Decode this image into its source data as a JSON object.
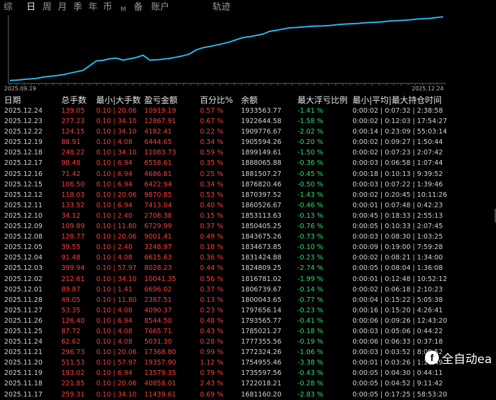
{
  "tabs": [
    {
      "label": "综",
      "active": false
    },
    {
      "label": "日",
      "active": true
    },
    {
      "label": "周",
      "active": false
    },
    {
      "label": "月",
      "active": false
    },
    {
      "label": "季",
      "active": false
    },
    {
      "label": "年",
      "active": false
    },
    {
      "label": "币",
      "active": false
    },
    {
      "label": "M",
      "active": false
    },
    {
      "label": "备",
      "active": false
    },
    {
      "label": "账户",
      "active": false
    }
  ],
  "chart": {
    "title": "轨迹",
    "x_start_label": "2025.09.19",
    "x_end_label": "2025.12.24",
    "line_color": "#2ab6f2"
  },
  "chart_data": {
    "type": "line",
    "title": "轨迹",
    "x_range": [
      "2025.09.19",
      "2025.12.24"
    ],
    "series": [
      {
        "values": [
          1002000,
          1008000,
          1018000,
          1026000,
          1034000,
          1052000,
          1064000,
          1074000,
          1088000,
          1110000,
          1130000,
          1152000,
          1220000,
          1290000,
          1298000,
          1320000,
          1330000,
          1300000,
          1320000,
          1340000,
          1372000,
          1300000,
          1305000,
          1314000,
          1326000,
          1344000,
          1364000,
          1392000,
          1452000,
          1482000,
          1500000,
          1520000,
          1542000,
          1566000,
          1600000,
          1630000,
          1642000,
          1662000,
          1681160,
          1722018,
          1735597,
          1754955,
          1772324,
          1777355,
          1785021,
          1793565,
          1797656,
          1800043,
          1806739,
          1816781,
          1824809,
          1831424,
          1834673,
          1843675,
          1850405,
          1853113,
          1860526,
          1870397,
          1876820,
          1881507,
          1888065,
          1899149,
          1905594,
          1909776,
          1922644,
          1933563
        ]
      }
    ],
    "color": "#2ab6f2"
  },
  "table": {
    "headers": {
      "date": "日期",
      "lots": "总手数",
      "minmax": "最小|大手数",
      "pl": "盈亏金额",
      "pct": "百分比%",
      "balance": "余额",
      "float": "最大浮亏比例",
      "time": "最小|平均|最大持仓时间"
    },
    "rows": [
      {
        "date": "2025.12.24",
        "lots": "139.05",
        "minmax": "0.10 | 20.06",
        "pl": "10919.19",
        "pct": "0.57 %",
        "balance": "1933563.77",
        "float": "-1.41 %",
        "time": "0:00:02 | 0:07:32 | 2:38:58"
      },
      {
        "date": "2025.12.23",
        "lots": "277.23",
        "minmax": "0.10 | 34.10",
        "pl": "12867.91",
        "pct": "0.67 %",
        "balance": "1922644.58",
        "float": "-1.58 %",
        "time": "0:00:02 | 0:12:03 | 17:54:27"
      },
      {
        "date": "2025.12.22",
        "lots": "124.15",
        "minmax": "0.10 | 34.10",
        "pl": "4182.41",
        "pct": "0.22 %",
        "balance": "1909776.67",
        "float": "-2.02 %",
        "time": "0:00:14 | 0:23:09 | 55:03:14"
      },
      {
        "date": "2025.12.19",
        "lots": "88.91",
        "minmax": "0.10 | 4.08",
        "pl": "6444.65",
        "pct": "0.34 %",
        "balance": "1905594.26",
        "float": "-0.20 %",
        "time": "0:00:02 | 0:09:27 | 1:50:44"
      },
      {
        "date": "2025.12.18",
        "lots": "248.22",
        "minmax": "0.10 | 34.10",
        "pl": "11083.73",
        "pct": "0.59 %",
        "balance": "1899149.61",
        "float": "-1.50 %",
        "time": "0:00:02 | 0:07:23 | 2:07:42"
      },
      {
        "date": "2025.12.17",
        "lots": "98.48",
        "minmax": "0.10 | 6.94",
        "pl": "6558.61",
        "pct": "0.35 %",
        "balance": "1888065.88",
        "float": "-0.36 %",
        "time": "0:00:03 | 0:06:58 | 1:07:44"
      },
      {
        "date": "2025.12.16",
        "lots": "71.42",
        "minmax": "0.10 | 6.94",
        "pl": "4686.81",
        "pct": "0.25 %",
        "balance": "1881507.27",
        "float": "-0.45 %",
        "time": "0:00:18 | 0:10:13 | 9:39:52"
      },
      {
        "date": "2025.12.15",
        "lots": "106.50",
        "minmax": "0.10 | 6.94",
        "pl": "6422.94",
        "pct": "0.34 %",
        "balance": "1876820.46",
        "float": "-0.50 %",
        "time": "0:00:03 | 0:07:22 | 1:39:46"
      },
      {
        "date": "2025.12.12",
        "lots": "118.03",
        "minmax": "0.10 | 20.06",
        "pl": "9870.85",
        "pct": "0.53 %",
        "balance": "1870397.52",
        "float": "-1.43 %",
        "time": "0:00:02 | 0:20:45 | 10:11:26"
      },
      {
        "date": "2025.12.11",
        "lots": "133.52",
        "minmax": "0.10 | 6.94",
        "pl": "7413.04",
        "pct": "0.40 %",
        "balance": "1860526.67",
        "float": "-0.46 %",
        "time": "0:00:01 | 0:07:48 | 0:42:23"
      },
      {
        "date": "2025.12.10",
        "lots": "34.12",
        "minmax": "0.10 | 2.40",
        "pl": "2708.38",
        "pct": "0.15 %",
        "balance": "1853113.63",
        "float": "-0.13 %",
        "time": "0:00:45 | 0:18:33 | 2:55:13"
      },
      {
        "date": "2025.12.09",
        "lots": "109.89",
        "minmax": "0.10 | 11.80",
        "pl": "6729.99",
        "pct": "0.37 %",
        "balance": "1850405.25",
        "float": "-0.76 %",
        "time": "0:00:05 | 0:10:33 | 2:07:45"
      },
      {
        "date": "2025.12.08",
        "lots": "128.77",
        "minmax": "0.10 | 20.06",
        "pl": "9001.41",
        "pct": "0.49 %",
        "balance": "1843675.26",
        "float": "-0.73 %",
        "time": "0:00:03 | 0:08:30 | 1:03:25"
      },
      {
        "date": "2025.12.05",
        "lots": "39.55",
        "minmax": "0.10 | 2.40",
        "pl": "3248.97",
        "pct": "0.18 %",
        "balance": "1834673.85",
        "float": "-0.10 %",
        "time": "0:00:09 | 0:19:00 | 7:59:28"
      },
      {
        "date": "2025.12.04",
        "lots": "91.48",
        "minmax": "0.10 | 4.08",
        "pl": "6615.63",
        "pct": "0.36 %",
        "balance": "1831424.88",
        "float": "-0.23 %",
        "time": "0:00:02 | 0:08:21 | 1:34:00"
      },
      {
        "date": "2025.12.03",
        "lots": "399.94",
        "minmax": "0.10 | 57.97",
        "pl": "8028.23",
        "pct": "0.44 %",
        "balance": "1824809.25",
        "float": "-2.74 %",
        "time": "0:00:05 | 0:08:04 | 1:36:08"
      },
      {
        "date": "2025.12.02",
        "lots": "212.61",
        "minmax": "0.10 | 34.10",
        "pl": "10041.35",
        "pct": "0.56 %",
        "balance": "1816781.02",
        "float": "-1.99 %",
        "time": "0:00:01 | 0:12:48 | 10:52:12"
      },
      {
        "date": "2025.12.01",
        "lots": "89.87",
        "minmax": "0.10 | 1.41",
        "pl": "6696.02",
        "pct": "0.37 %",
        "balance": "1806739.67",
        "float": "-0.14 %",
        "time": "0:00:02 | 0:06:18 | 2:10:23"
      },
      {
        "date": "2025.11.28",
        "lots": "49.05",
        "minmax": "0.10 | 11.80",
        "pl": "2387.51",
        "pct": "0.13 %",
        "balance": "1800043.65",
        "float": "-0.77 %",
        "time": "0:00:04 | 0:15:22 | 5:05:38"
      },
      {
        "date": "2025.11.27",
        "lots": "53.35",
        "minmax": "0.10 | 4.08",
        "pl": "4090.37",
        "pct": "0.23 %",
        "balance": "1797656.14",
        "float": "-0.23 %",
        "time": "0:00:16 | 0:15:20 | 4:26:41"
      },
      {
        "date": "2025.11.26",
        "lots": "126.40",
        "minmax": "0.10 | 6.94",
        "pl": "8544.50",
        "pct": "0.48 %",
        "balance": "1793565.77",
        "float": "-0.41 %",
        "time": "0:00:06 | 0:09:26 | 12:43:20"
      },
      {
        "date": "2025.11.25",
        "lots": "87.72",
        "minmax": "0.10 | 4.08",
        "pl": "7665.71",
        "pct": "0.43 %",
        "balance": "1785021.27",
        "float": "-0.18 %",
        "time": "0:00:03 | 0:05:06 | 0:44:22"
      },
      {
        "date": "2025.11.24",
        "lots": "62.62",
        "minmax": "0.10 | 4.08",
        "pl": "5031.30",
        "pct": "0.28 %",
        "balance": "1777355.56",
        "float": "-0.19 %",
        "time": "0:00:06 | 0:06:33 | 0:37:18"
      },
      {
        "date": "2025.11.21",
        "lots": "296.73",
        "minmax": "0.10 | 20.06",
        "pl": "17368.80",
        "pct": "0.99 %",
        "balance": "1772324.26",
        "float": "-1.06 %",
        "time": "0:00:03 | 0:03:52 | 8:09:52"
      },
      {
        "date": "2025.11.20",
        "lots": "511.53",
        "minmax": "0.10 | 57.97",
        "pl": "19357.90",
        "pct": "1.12 %",
        "balance": "1754955.46",
        "float": "-3.38 %",
        "time": "0:00:01 | 0:03:26 | 1:10:49"
      },
      {
        "date": "2025.11.19",
        "lots": "193.02",
        "minmax": "0.10 | 6.94",
        "pl": "13579.35",
        "pct": "0.79 %",
        "balance": "1735597.56",
        "float": "-0.43 %",
        "time": "0:00:05 | 0:04:30 | 0:44:11"
      },
      {
        "date": "2025.11.18",
        "lots": "221.85",
        "minmax": "0.10 | 20.06",
        "pl": "40858.01",
        "pct": "2.43 %",
        "balance": "1722018.21",
        "float": "-0.28 %",
        "time": "0:00:05 | 0:04:52 | 9:11:42"
      },
      {
        "date": "2025.11.17",
        "lots": "259.31",
        "minmax": "0.10 | 34.10",
        "pl": "11439.61",
        "pct": "0.69 %",
        "balance": "1681160.20",
        "float": "-2.83 %",
        "time": "0:00:05 | 0:17:25 | 58:53:20"
      }
    ]
  },
  "watermark": {
    "icon": "facebook-icon",
    "text": "全自动ea"
  }
}
